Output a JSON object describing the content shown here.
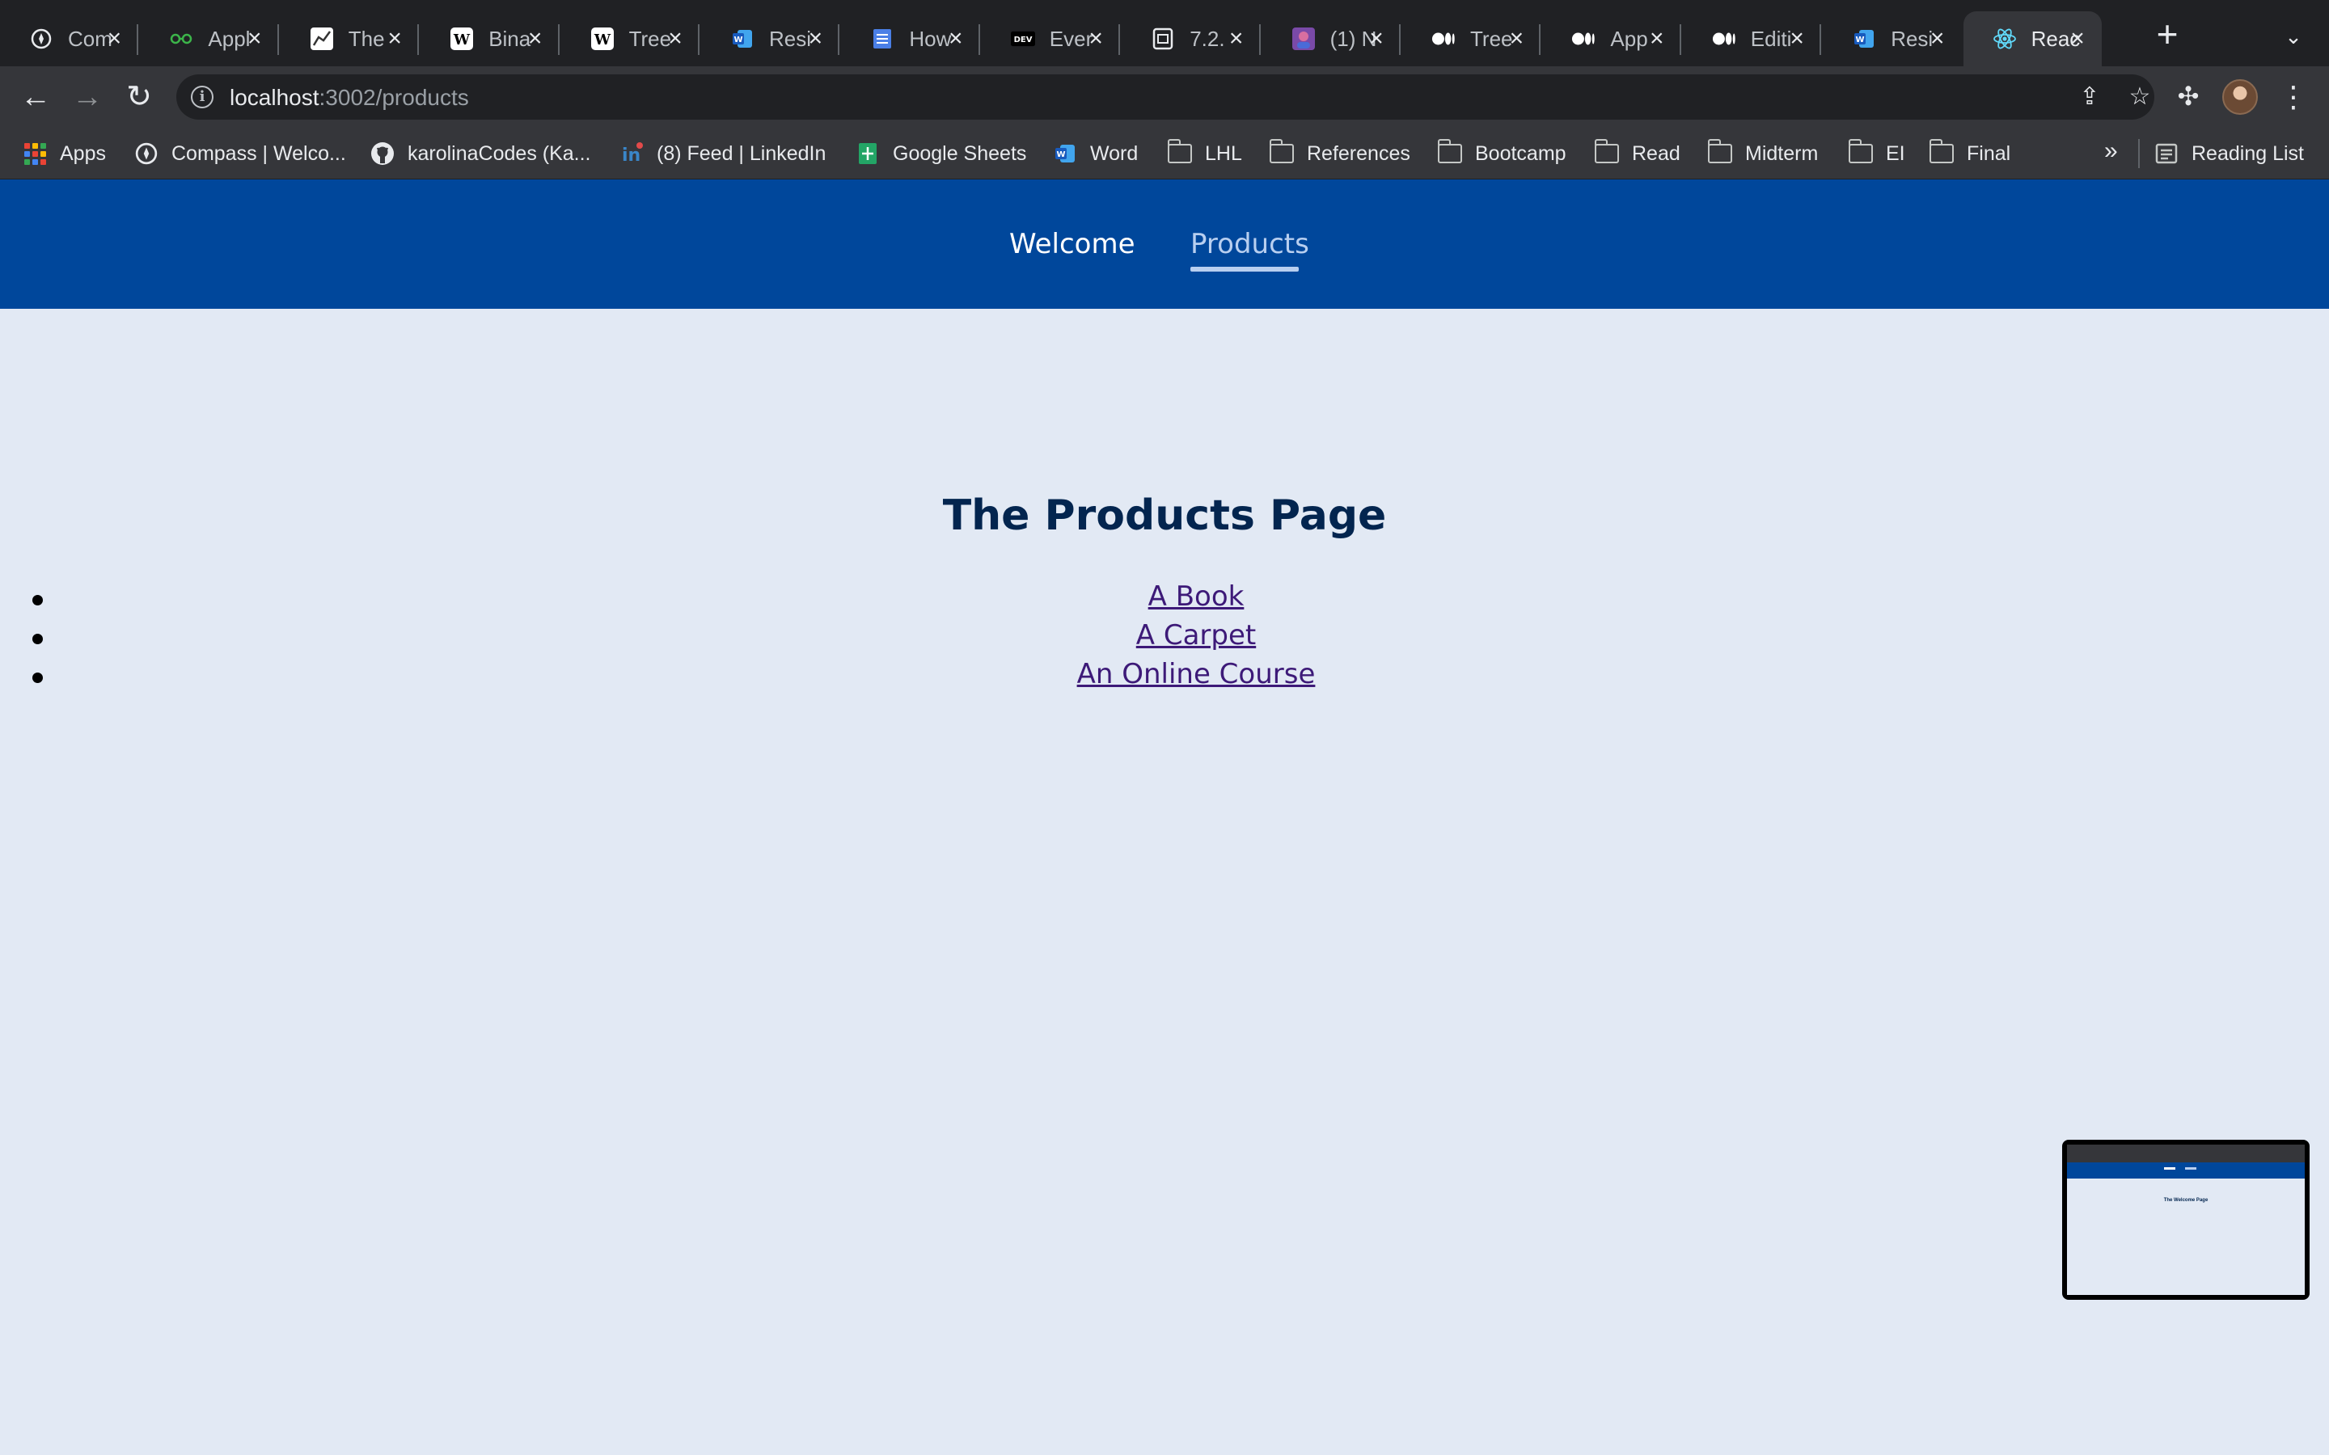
{
  "tabs": [
    {
      "label": "Com",
      "icon": "compass-icon",
      "active": false
    },
    {
      "label": "Appl",
      "icon": "glasses-icon",
      "active": false
    },
    {
      "label": "The",
      "icon": "chart-icon",
      "active": false
    },
    {
      "label": "Bina",
      "icon": "wikipedia-icon",
      "active": false
    },
    {
      "label": "Tree",
      "icon": "wikipedia-icon",
      "active": false
    },
    {
      "label": "Resi",
      "icon": "word-icon",
      "active": false
    },
    {
      "label": "How",
      "icon": "docs-icon",
      "active": false
    },
    {
      "label": "Ever",
      "icon": "dev-icon",
      "active": false
    },
    {
      "label": "7.2.",
      "icon": "sheet-icon",
      "active": false
    },
    {
      "label": "(1) N",
      "icon": "avatar-icon",
      "active": false
    },
    {
      "label": "Tree",
      "icon": "medium-icon",
      "active": false
    },
    {
      "label": "App",
      "icon": "medium-icon",
      "active": false
    },
    {
      "label": "Editi",
      "icon": "medium-icon",
      "active": false
    },
    {
      "label": "Resi",
      "icon": "word-icon",
      "active": false
    },
    {
      "label": "Reac",
      "icon": "react-icon",
      "active": true
    }
  ],
  "address_bar": {
    "host": "localhost",
    "rest": ":3002/products"
  },
  "bookmarks": [
    {
      "label": "Apps",
      "icon": "apps-grid-icon"
    },
    {
      "label": "Compass | Welco...",
      "icon": "compass-icon"
    },
    {
      "label": "karolinaCodes (Ka...",
      "icon": "github-icon"
    },
    {
      "label": "(8) Feed | LinkedIn",
      "icon": "linkedin-icon"
    },
    {
      "label": "Google Sheets",
      "icon": "google-sheets-icon"
    },
    {
      "label": "Word",
      "icon": "word-icon"
    },
    {
      "label": "LHL",
      "icon": "folder-icon"
    },
    {
      "label": "References",
      "icon": "folder-icon"
    },
    {
      "label": "Bootcamp",
      "icon": "folder-icon"
    },
    {
      "label": "Read",
      "icon": "folder-icon"
    },
    {
      "label": "Midterm",
      "icon": "folder-icon"
    },
    {
      "label": "EI",
      "icon": "folder-icon"
    },
    {
      "label": "Final",
      "icon": "folder-icon"
    }
  ],
  "bookmarks_more": "»",
  "reading_list": "Reading List",
  "app_nav": {
    "welcome": "Welcome",
    "products": "Products",
    "active": "Products"
  },
  "page": {
    "title": "The Products Page",
    "products": [
      "A Book",
      "A Carpet",
      "An Online Course"
    ]
  },
  "thumbnail": {
    "title": "The Welcome Page"
  },
  "colors": {
    "nav_bg": "#00479b",
    "page_bg": "#e2e9f4",
    "title": "#03254f",
    "link": "#3d1a78"
  }
}
